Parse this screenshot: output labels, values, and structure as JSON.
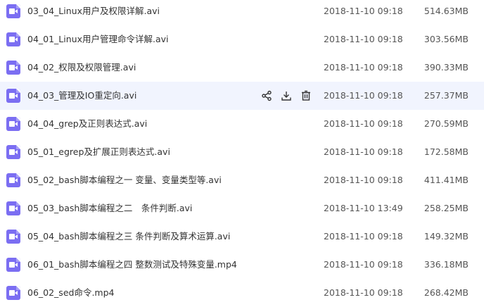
{
  "files": [
    {
      "name": "03_04_Linux用户及权限详解.avi",
      "time": "2018-11-10 09:18",
      "size": "514.63MB"
    },
    {
      "name": "04_01_Linux用户管理命令详解.avi",
      "time": "2018-11-10 09:18",
      "size": "303.56MB"
    },
    {
      "name": "04_02_权限及权限管理.avi",
      "time": "2018-11-10 09:18",
      "size": "390.33MB"
    },
    {
      "name": "04_03_管理及IO重定向.avi",
      "time": "2018-11-10 09:18",
      "size": "257.37MB"
    },
    {
      "name": "04_04_grep及正则表达式.avi",
      "time": "2018-11-10 09:18",
      "size": "270.59MB"
    },
    {
      "name": "05_01_egrep及扩展正则表达式.avi",
      "time": "2018-11-10 09:18",
      "size": "172.58MB"
    },
    {
      "name": "05_02_bash脚本编程之一 变量、变量类型等.avi",
      "time": "2018-11-10 09:18",
      "size": "411.41MB"
    },
    {
      "name": "05_03_bash脚本编程之二　条件判断.avi",
      "time": "2018-11-10 13:49",
      "size": "258.25MB"
    },
    {
      "name": "05_04_bash脚本编程之三 条件判断及算术运算.avi",
      "time": "2018-11-10 09:18",
      "size": "149.32MB"
    },
    {
      "name": "06_01_bash脚本编程之四 整数测试及特殊变量.mp4",
      "time": "2018-11-10 09:18",
      "size": "336.18MB"
    },
    {
      "name": "06_02_sed命令.mp4",
      "time": "2018-11-10 09:18",
      "size": "268.42MB"
    }
  ],
  "hover_row": 3,
  "icons": {
    "file": "video-file-icon",
    "share": "share-icon",
    "download": "download-icon",
    "delete": "trash-icon"
  },
  "colors": {
    "icon": "#7b6ef2",
    "hover_bg": "#f1f4fe",
    "text": "#333333"
  }
}
